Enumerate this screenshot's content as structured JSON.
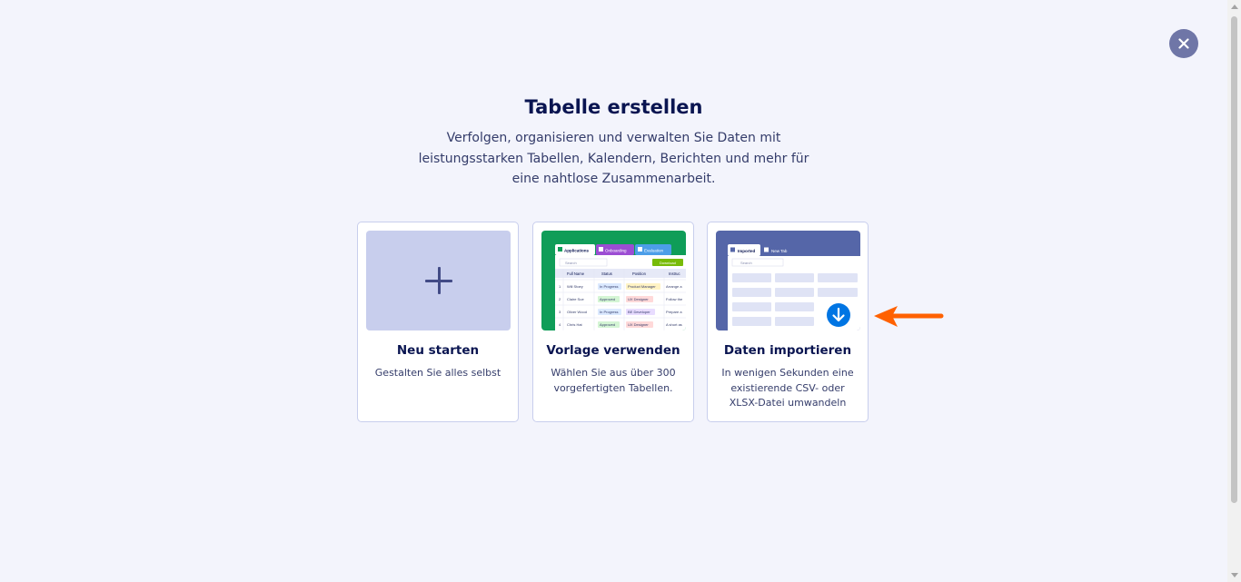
{
  "header": {
    "title": "Tabelle erstellen",
    "subtitle": "Verfolgen, organisieren und verwalten Sie Daten mit leistungsstarken Tabellen, Kalendern, Berichten und mehr für eine nahtlose Zusammenarbeit."
  },
  "close_icon": "close-icon",
  "cards": [
    {
      "title": "Neu starten",
      "description": "Gestalten Sie alles selbst",
      "icon": "plus-icon"
    },
    {
      "title": "Vorlage verwenden",
      "description": "Wählen Sie aus über 300 vorgefertigten Tabellen."
    },
    {
      "title": "Daten importieren",
      "description": "In wenigen Sekunden eine existierende CSV- oder XLSX-Datei umwandeln",
      "icon": "download-icon"
    }
  ],
  "template_preview": {
    "tabs": [
      "Applications",
      "Onboarding",
      "Evaluation"
    ],
    "search_placeholder": "Search",
    "download_label": "Download",
    "columns": [
      "Full Name",
      "Status",
      "Position",
      "Instruc"
    ],
    "rows": [
      {
        "num": "1",
        "name": "Will Stoey",
        "status": "In Progress",
        "position": "Product Manager",
        "note": "Arrange a"
      },
      {
        "num": "2",
        "name": "Claire Sue",
        "status": "Approved",
        "position": "UX Designer",
        "note": "Follow the"
      },
      {
        "num": "3",
        "name": "Oliver Wood",
        "status": "In Progress",
        "position": "BE Developer",
        "note": "Prepare a"
      },
      {
        "num": "4",
        "name": "Chris Hat",
        "status": "Approved",
        "position": "UX Designer",
        "note": "A short as"
      }
    ]
  },
  "import_preview": {
    "tabs": [
      "Imported",
      "New Tab"
    ],
    "search_placeholder": "Search"
  },
  "colors": {
    "background": "#f3f4fc",
    "navy": "#0a1551",
    "template_green": "#0f9d58",
    "import_blue": "#5566a8",
    "arrow_orange": "#ff6100",
    "download_button": "#0075e3"
  }
}
